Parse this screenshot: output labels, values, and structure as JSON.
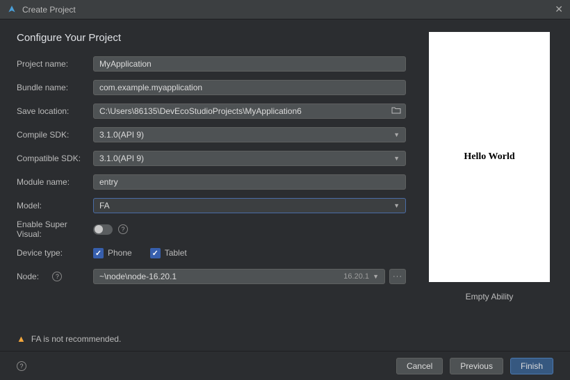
{
  "titlebar": {
    "title": "Create Project"
  },
  "heading": "Configure Your Project",
  "labels": {
    "project_name": "Project name:",
    "bundle_name": "Bundle name:",
    "save_location": "Save location:",
    "compile_sdk": "Compile SDK:",
    "compatible_sdk": "Compatible SDK:",
    "module_name": "Module name:",
    "model": "Model:",
    "enable_super_visual": "Enable Super Visual:",
    "device_type": "Device type:",
    "node": "Node:"
  },
  "fields": {
    "project_name": "MyApplication",
    "bundle_name": "com.example.myapplication",
    "save_location": "C:\\Users\\86135\\DevEcoStudioProjects\\MyApplication6",
    "compile_sdk": "3.1.0(API 9)",
    "compatible_sdk": "3.1.0(API 9)",
    "module_name": "entry",
    "model": "FA",
    "node_path": "~\\node\\node-16.20.1",
    "node_version": "16.20.1"
  },
  "device_types": {
    "phone": "Phone",
    "tablet": "Tablet"
  },
  "preview": {
    "text": "Hello World",
    "caption": "Empty Ability"
  },
  "warning": "FA is not recommended.",
  "buttons": {
    "cancel": "Cancel",
    "previous": "Previous",
    "finish": "Finish"
  }
}
